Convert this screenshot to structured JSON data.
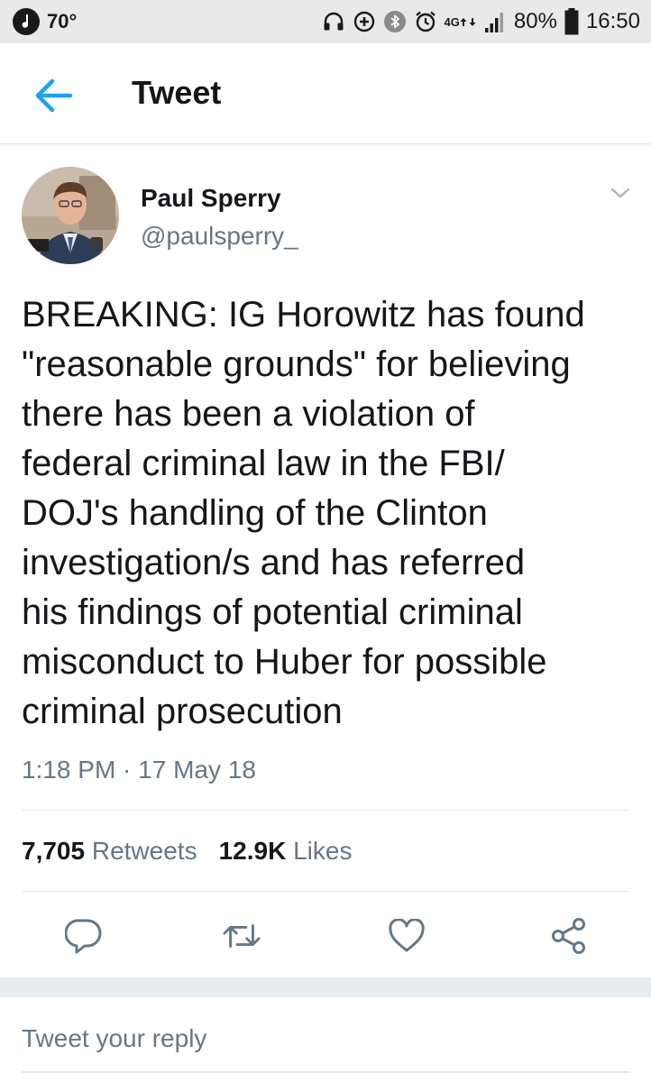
{
  "status_bar": {
    "temperature": "70°",
    "network": "4G",
    "battery": "80%",
    "time": "16:50"
  },
  "header": {
    "title": "Tweet",
    "back_icon": "arrow-left-icon"
  },
  "tweet": {
    "author_name": "Paul Sperry",
    "author_handle": "@paulsperry_",
    "lines": [
      "BREAKING: IG Horowitz has found",
      "\"reasonable grounds\" for believing",
      "there has been a violation of",
      "federal criminal law in the FBI/",
      "DOJ's handling of the Clinton",
      "investigation/s and has referred",
      "his findings of potential criminal",
      "misconduct to Huber for possible",
      "criminal prosecution"
    ],
    "timestamp": "1:18 PM · 17 May 18"
  },
  "stats": {
    "retweets_count": "7,705",
    "retweets_label": "Retweets",
    "likes_count": "12.9K",
    "likes_label": "Likes"
  },
  "actions": [
    "reply-icon",
    "retweet-icon",
    "like-icon",
    "share-icon"
  ],
  "reply": {
    "placeholder": "Tweet your reply"
  },
  "colors": {
    "accent": "#1da1f2",
    "secondary_text": "#657786",
    "primary_text": "#14171a",
    "divider": "#e1e8ed"
  }
}
